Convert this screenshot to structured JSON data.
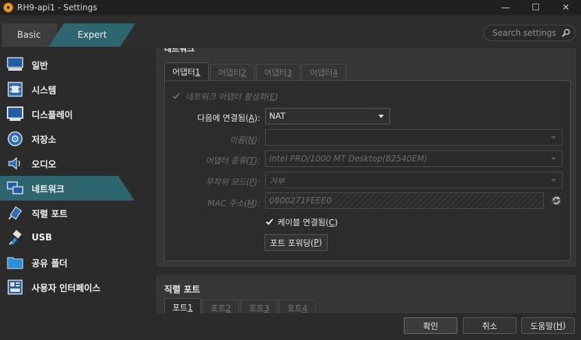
{
  "window": {
    "title": "RH9-api1 - Settings",
    "controls": [
      "—",
      "☐",
      "✕"
    ]
  },
  "toolbar": {
    "mode_basic": "Basic",
    "mode_expert": "Expert",
    "search_placeholder": "Search settings"
  },
  "sidebar": {
    "items": [
      {
        "label": "일반",
        "icon": "monitor-icon"
      },
      {
        "label": "시스템",
        "icon": "chip-icon"
      },
      {
        "label": "디스플레이",
        "icon": "display-icon"
      },
      {
        "label": "저장소",
        "icon": "disk-icon"
      },
      {
        "label": "오디오",
        "icon": "speaker-icon"
      },
      {
        "label": "네트워크",
        "icon": "network-icon"
      },
      {
        "label": "직렬 포트",
        "icon": "serial-port-icon"
      },
      {
        "label": "USB",
        "icon": "usb-icon"
      },
      {
        "label": "공유 폴더",
        "icon": "folder-icon"
      },
      {
        "label": "사용자 인터페이스",
        "icon": "ui-icon"
      }
    ],
    "selected": "네트워크"
  },
  "network": {
    "section_title": "네트워크",
    "tabs": [
      {
        "label": "어댑터 ",
        "key": "1"
      },
      {
        "label": "어댑터 ",
        "key": "2"
      },
      {
        "label": "어댑터 ",
        "key": "3"
      },
      {
        "label": "어댑터 ",
        "key": "4"
      }
    ],
    "enable_adapter": {
      "label": "네트워크 어댑터 활성화(",
      "key": "E",
      "tail": ")"
    },
    "attached_to": {
      "label": "다음에 연결됨(",
      "key": "A",
      "tail": "):",
      "value": "NAT"
    },
    "name": {
      "label": "이름(",
      "key": "N",
      "tail": "):"
    },
    "adapter_type": {
      "label": "어댑터 종류(",
      "key": "T",
      "tail": "):",
      "value": "Intel PRO/1000 MT Desktop(82540EM)"
    },
    "promiscuous": {
      "label": "무작위 모드(",
      "key": "P",
      "tail": "):",
      "value": "거부"
    },
    "mac": {
      "label": "MAC 주소(",
      "key": "M",
      "tail": "):",
      "value": "0800271FEEE0"
    },
    "cable": {
      "label": "케이블 연결됨(",
      "key": "C",
      "tail": ")"
    },
    "port_forwarding": {
      "label": "포트 포워딩(",
      "key": "P",
      "tail": ")"
    }
  },
  "serial": {
    "section_title": "직렬 포트",
    "tabs": [
      {
        "label": "포트 ",
        "key": "1"
      },
      {
        "label": "포트 ",
        "key": "2"
      },
      {
        "label": "포트 ",
        "key": "3"
      },
      {
        "label": "포트 ",
        "key": "4"
      }
    ]
  },
  "buttons": {
    "ok": "확인",
    "cancel": "취소",
    "help_label": "도움말(",
    "help_key": "H",
    "help_tail": ")"
  }
}
